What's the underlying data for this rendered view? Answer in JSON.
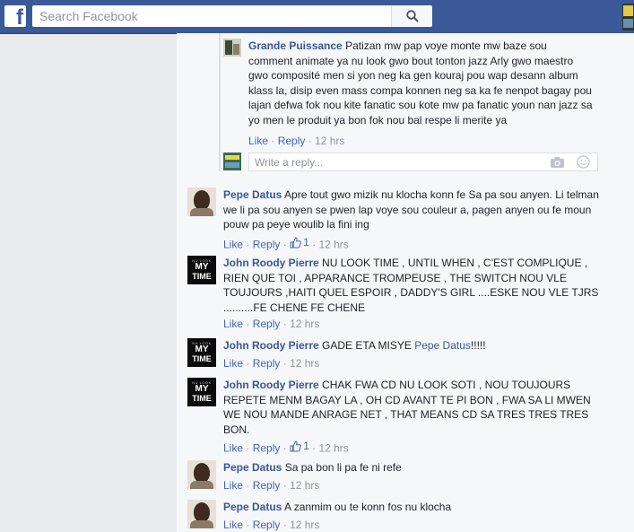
{
  "header": {
    "logo": "f",
    "search_placeholder": "Search Facebook"
  },
  "reply_thread": {
    "reply": {
      "author": "Grande Puissance",
      "text_lines": [
        "Patizan mw pap voye monte mw baze sou",
        "comment animate ya nu look gwo bout tonton jazz Arly gwo maestro",
        "gwo composité men si yon neg ka gen kouraj pou wap desann album",
        "klass la, disip even mass compa konnen neg sa ka fe nenpot bagay pou",
        "lajan defwa fok nou kite fanatic sou kote mw pa fanatic youn nan jazz sa",
        "yo men le produit ya bon fok nou bal respe li merite ya"
      ],
      "like": "Like",
      "reply": "Reply",
      "time": "12 hrs"
    },
    "reply_box": {
      "placeholder": "Write a reply..."
    }
  },
  "comments": [
    {
      "author": "Pepe Datus",
      "lines": [
        "Apre tout gwo mizik nu klocha konn fe Sa pa sou anyen. Li telman",
        "we li pa sou anyen se pwen lap voye sou couleur a, pagen anyen ou fe moun",
        "pouw pa peye woulib la fini ing"
      ],
      "like": "Like",
      "reply": "Reply",
      "likes": "1",
      "time": "12 hrs"
    },
    {
      "author": "John Roody Pierre",
      "lines": [
        "NU LOOK TIME , UNTIL WHEN , C'EST COMPLIQUE ,",
        "RIEN QUE TOI , APPARANCE TROMPEUSE , THE SWITCH NOU VLE",
        "TOUJOURS ,HAITI QUEL ESPOIR , DADDY'S GIRL ....ESKE NOU VLE TJRS",
        "..........FE CHENE FE CHENE"
      ],
      "like": "Like",
      "reply": "Reply",
      "time": "12 hrs"
    },
    {
      "author": "John Roody Pierre",
      "text": "GADE ETA MISYE",
      "mention": "Pepe Datus",
      "suffix": "!!!!!",
      "like": "Like",
      "reply": "Reply",
      "time": "12 hrs"
    },
    {
      "author": "John Roody Pierre",
      "lines": [
        "CHAK FWA CD NU LOOK SOTI , NOU TOUJOURS",
        "REPETE MENM BAGAY LA , OH CD AVANT TE PI BON , FWA SA LI MWEN",
        "WE NOU MANDE ANRAGE NET , THAT MEANS CD SA TRES TRES TRES",
        "BON."
      ],
      "like": "Like",
      "reply": "Reply",
      "likes": "1",
      "time": "12 hrs"
    },
    {
      "author": "Pepe Datus",
      "text": "Sa pa bon li pa fe ni refe",
      "like": "Like",
      "reply": "Reply",
      "time": "12 hrs"
    },
    {
      "author": "Pepe Datus",
      "text": "A zanmim ou te konn fos nu klocha",
      "like": "Like",
      "reply": "Reply",
      "time": "12 hrs"
    }
  ],
  "avatar_labels": {
    "mytime_sub": "NU LOOK",
    "mytime_top": "MY",
    "mytime_bottom": "TIME"
  },
  "icons": [
    "facebook-logo-icon",
    "search-icon",
    "camera-icon",
    "emoji-icon",
    "thumbs-up-icon"
  ]
}
